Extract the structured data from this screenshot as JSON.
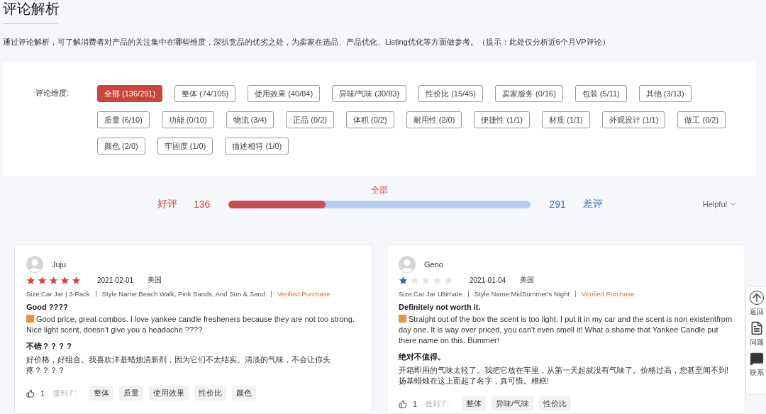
{
  "title": "评论解析",
  "description": "通过评论解析，可了解消费者对产品的关注集中在哪些维度，深扒竞品的优劣之处，为卖家在选品、产品优化、Listing优化等方面做参考。（提示：此处仅分析近6个月VP评论）",
  "filter": {
    "label": "评论维度:",
    "tags": [
      {
        "label": "全部 (136/291)",
        "selected": true
      },
      {
        "label": "整体 (74/105)",
        "selected": false
      },
      {
        "label": "使用效果 (40/84)",
        "selected": false
      },
      {
        "label": "异味/气味 (30/83)",
        "selected": false
      },
      {
        "label": "性价比 (15/45)",
        "selected": false
      },
      {
        "label": "卖家服务 (0/16)",
        "selected": false
      },
      {
        "label": "包装 (5/11)",
        "selected": false
      },
      {
        "label": "其他 (3/13)",
        "selected": false
      },
      {
        "label": "质量 (6/10)",
        "selected": false
      },
      {
        "label": "功能 (0/10)",
        "selected": false
      },
      {
        "label": "物流 (3/4)",
        "selected": false
      },
      {
        "label": "正品 (0/2)",
        "selected": false
      },
      {
        "label": "体积 (0/2)",
        "selected": false
      },
      {
        "label": "耐用性 (2/0)",
        "selected": false
      },
      {
        "label": "便捷性 (1/1)",
        "selected": false
      },
      {
        "label": "材质 (1/1)",
        "selected": false
      },
      {
        "label": "外观设计 (1/1)",
        "selected": false
      },
      {
        "label": "做工 (0/2)",
        "selected": false
      },
      {
        "label": "颜色 (2/0)",
        "selected": false
      },
      {
        "label": "牢固度 (1/0)",
        "selected": false
      },
      {
        "label": "描述相符 (1/0)",
        "selected": false
      }
    ]
  },
  "summary": {
    "positive_label": "好评",
    "positive_count": "136",
    "bar_label": "全部",
    "level": 0.32,
    "negative_count": "291",
    "negative_label": "差评",
    "sort": "Helpful"
  },
  "reviews": [
    {
      "name": "Juju",
      "stars": 5,
      "date": "2021-02-01",
      "country": "美国",
      "size": "Size:Car Jar | 3-Pack",
      "style": "Style Name:Beach Walk, Pink Sands, And Sun & Sand",
      "verified": "Verified Purchase",
      "title": "Good ????",
      "body": "Good price, great combos. I love yankee candle fresheners because they are not too strong. Nice light scent, doesn’t give you a headache ????",
      "title_cn": "不错？？？？",
      "body_cn": "好价格，好组合。我喜欢洋基蜡烛清新剂，因为它们不太结实。清淡的气味，不会让你头疼？？？？",
      "likes": "1",
      "mentioned_label": "提到了:",
      "tags": [
        "整体",
        "质量",
        "使用效果",
        "性价比",
        "颜色"
      ]
    },
    {
      "name": "Geno",
      "stars": 1,
      "date": "2021-01-04",
      "country": "美国",
      "size": "Size:Car Jar Ultimate",
      "style": "Style Name:MidSummer's Night",
      "verified": "Verified Purchase",
      "title": "Definitely not worth it.",
      "body": "Straight out of the box the scent is too light. I put it in my car and the scent is non existentfrom day one. It is way over priced, you can't even smell it! What a shame that Yankee Candle put there name on this. Bummer!",
      "title_cn": "绝对不值得。",
      "body_cn": "开箱即用的气味太轻了。我把它放在车里，从第一天起就没有气味了。价格过高，您甚至闻不到!扬基蜡烛在这上面起了名字，真可惜。糟糕!",
      "likes": "1",
      "mentioned_label": "提到了:",
      "tags": [
        "整体",
        "异味/气味",
        "性价比"
      ]
    }
  ],
  "side_tools": [
    {
      "kind": "top",
      "label": "返回"
    },
    {
      "kind": "feedback",
      "label": "问题"
    },
    {
      "kind": "contact",
      "label": "联系"
    }
  ]
}
